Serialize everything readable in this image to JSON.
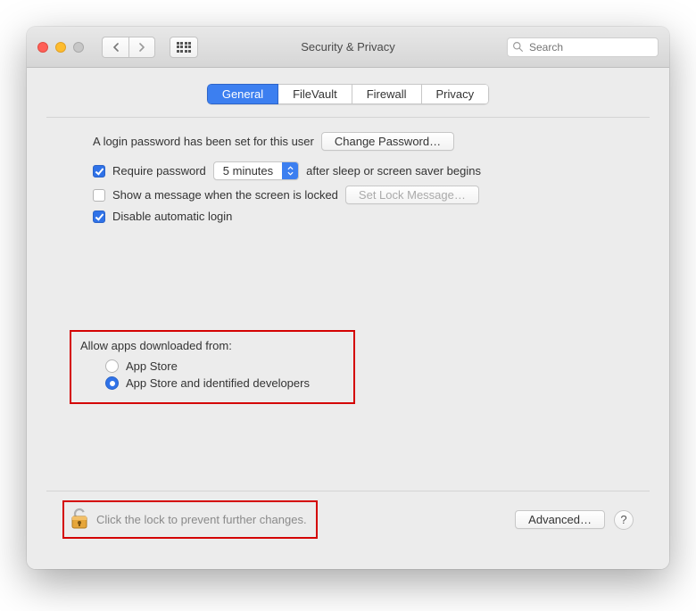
{
  "window": {
    "title": "Security & Privacy"
  },
  "toolbar": {
    "search_placeholder": "Search"
  },
  "tabs": {
    "general": "General",
    "filevault": "FileVault",
    "firewall": "Firewall",
    "privacy": "Privacy",
    "active": "general"
  },
  "general": {
    "login_pw_label": "A login password has been set for this user",
    "change_pw_btn": "Change Password…",
    "require_pw_label": "Require password",
    "require_pw_checked": true,
    "require_delay_value": "5 minutes",
    "require_pw_suffix": "after sleep or screen saver begins",
    "show_msg_label": "Show a message when the screen is locked",
    "show_msg_checked": false,
    "set_lock_btn": "Set Lock Message…",
    "disable_auto_label": "Disable automatic login",
    "disable_auto_checked": true,
    "allow_title": "Allow apps downloaded from:",
    "allow_opt1": "App Store",
    "allow_opt2": "App Store and identified developers",
    "allow_selected": "opt2"
  },
  "footer": {
    "lock_text": "Click the lock to prevent further changes.",
    "advanced_btn": "Advanced…",
    "help": "?"
  }
}
